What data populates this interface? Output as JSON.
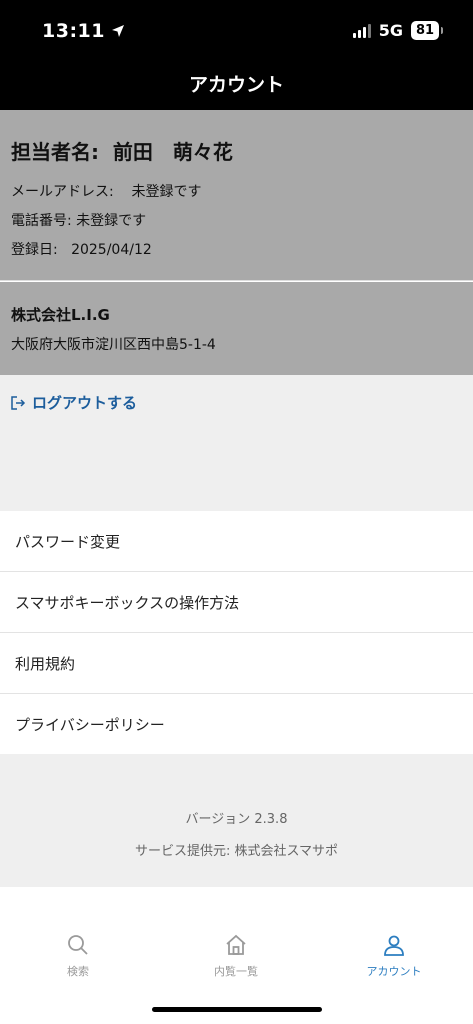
{
  "status_bar": {
    "time": "13:11",
    "network": "5G",
    "battery": "81"
  },
  "header": {
    "title": "アカウント"
  },
  "profile": {
    "name": "担当者名:  前田　萌々花",
    "email_label": "メールアドレス:",
    "email_value": "未登録です",
    "phone_label": "電話番号:",
    "phone_value": "未登録です",
    "registered_label": "登録日:",
    "registered_value": "2025/04/12"
  },
  "company": {
    "name": "株式会社L.I.G",
    "address": "大阪府大阪市淀川区西中島5-1-4"
  },
  "logout": {
    "label": "ログアウトする"
  },
  "menu": {
    "items": [
      {
        "label": "パスワード変更"
      },
      {
        "label": "スマサポキーボックスの操作方法"
      },
      {
        "label": "利用規約"
      },
      {
        "label": "プライバシーポリシー"
      }
    ]
  },
  "info": {
    "version": "バージョン 2.3.8",
    "provider": "サービス提供元: 株式会社スマサポ"
  },
  "tabs": [
    {
      "label": "検索",
      "icon": "search-icon",
      "active": false
    },
    {
      "label": "内覧一覧",
      "icon": "home-icon",
      "active": false
    },
    {
      "label": "アカウント",
      "icon": "person-icon",
      "active": true
    }
  ],
  "colors": {
    "accent": "#2d7ec0",
    "logout_link": "#1c5d9c",
    "profile_bg": "#a9a9a9"
  }
}
